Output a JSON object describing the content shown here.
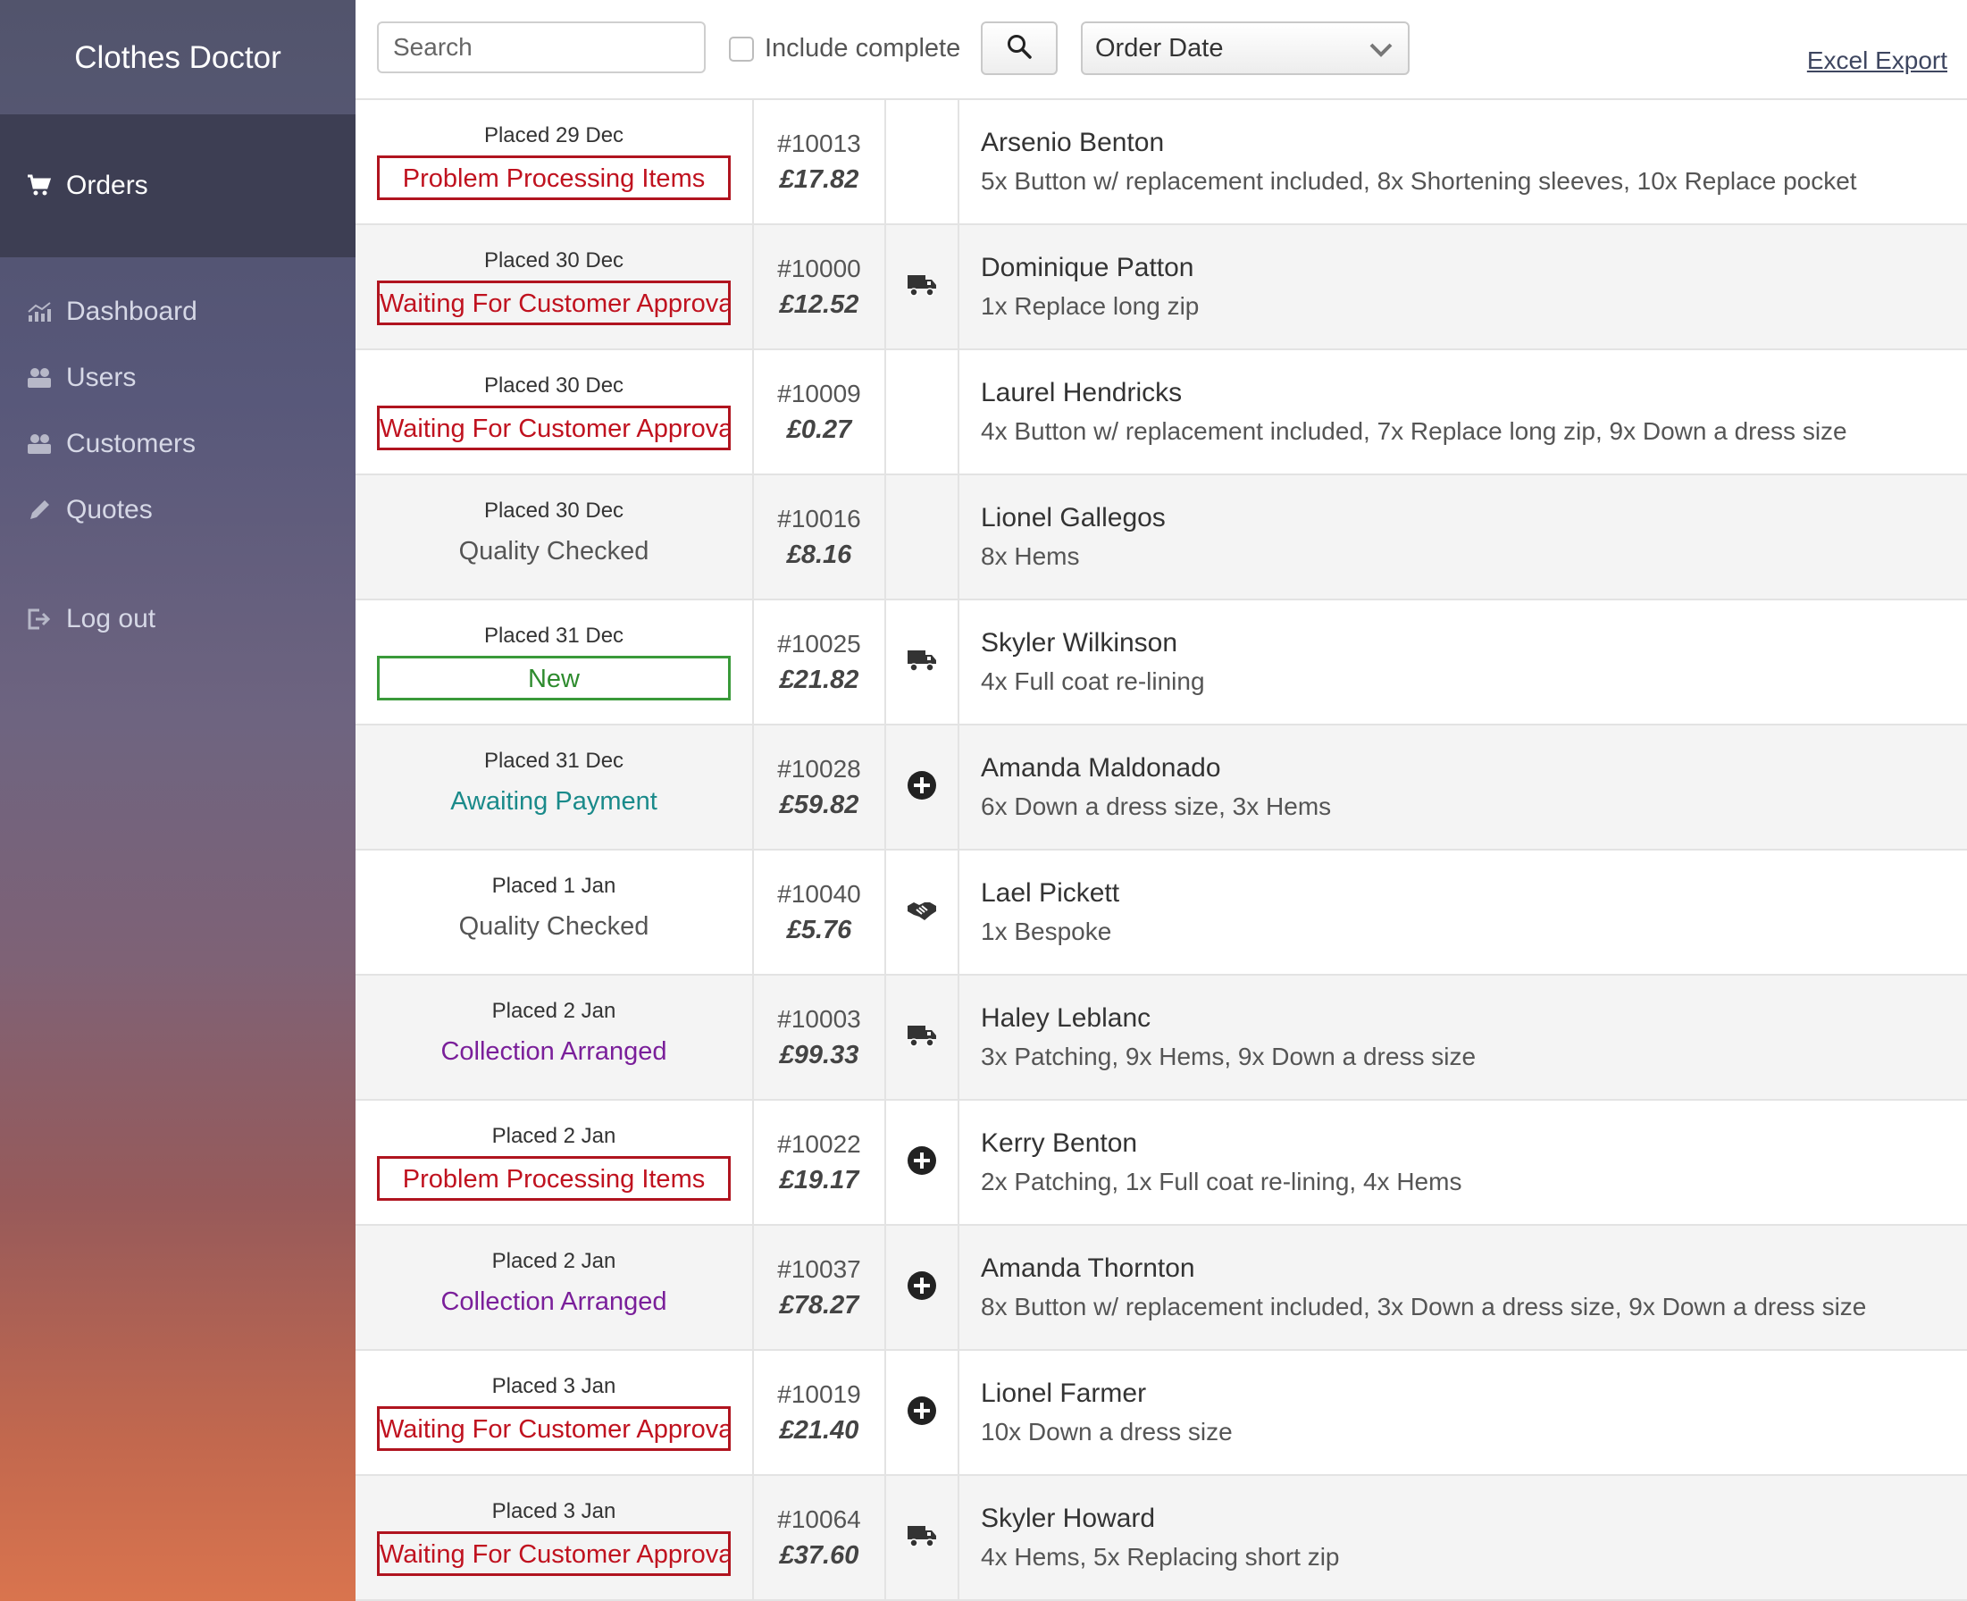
{
  "app": {
    "brand": "Clothes Doctor"
  },
  "sidebar": {
    "active": {
      "label": "Orders",
      "icon": "cart-icon"
    },
    "items": [
      {
        "label": "Dashboard",
        "icon": "chart-icon"
      },
      {
        "label": "Users",
        "icon": "users-icon"
      },
      {
        "label": "Customers",
        "icon": "users-icon"
      },
      {
        "label": "Quotes",
        "icon": "pencil-icon"
      }
    ],
    "logout": {
      "label": "Log out",
      "icon": "logout-icon"
    }
  },
  "toolbar": {
    "search_placeholder": "Search",
    "include_complete_label": "Include complete",
    "sort_value": "Order Date",
    "excel_export": "Excel Export"
  },
  "orders": [
    {
      "placed": "Placed 29 Dec",
      "status": "Problem Processing Items",
      "style": "red",
      "id": "#10013",
      "price": "£17.82",
      "icon": "",
      "customer": "Arsenio Benton",
      "items": "5x Button w/ replacement included, 8x Shortening sleeves, 10x Replace pocket"
    },
    {
      "placed": "Placed 30 Dec",
      "status": "Waiting For Customer Approval",
      "style": "red",
      "id": "#10000",
      "price": "£12.52",
      "icon": "truck",
      "customer": "Dominique Patton",
      "items": "1x Replace long zip"
    },
    {
      "placed": "Placed 30 Dec",
      "status": "Waiting For Customer Approval",
      "style": "red",
      "id": "#10009",
      "price": "£0.27",
      "icon": "",
      "customer": "Laurel Hendricks",
      "items": "4x Button w/ replacement included, 7x Replace long zip, 9x Down a dress size"
    },
    {
      "placed": "Placed 30 Dec",
      "status": "Quality Checked",
      "style": "plain",
      "id": "#10016",
      "price": "£8.16",
      "icon": "",
      "customer": "Lionel Gallegos",
      "items": "8x Hems"
    },
    {
      "placed": "Placed 31 Dec",
      "status": "New",
      "style": "green",
      "id": "#10025",
      "price": "£21.82",
      "icon": "truck",
      "customer": "Skyler Wilkinson",
      "items": "4x Full coat re-lining"
    },
    {
      "placed": "Placed 31 Dec",
      "status": "Awaiting Payment",
      "style": "teal",
      "id": "#10028",
      "price": "£59.82",
      "icon": "plus",
      "customer": "Amanda Maldonado",
      "items": "6x Down a dress size, 3x Hems"
    },
    {
      "placed": "Placed 1 Jan",
      "status": "Quality Checked",
      "style": "plain",
      "id": "#10040",
      "price": "£5.76",
      "icon": "handshake",
      "customer": "Lael Pickett",
      "items": "1x Bespoke"
    },
    {
      "placed": "Placed 2 Jan",
      "status": "Collection Arranged",
      "style": "purple",
      "id": "#10003",
      "price": "£99.33",
      "icon": "truck",
      "customer": "Haley Leblanc",
      "items": "3x Patching, 9x Hems, 9x Down a dress size"
    },
    {
      "placed": "Placed 2 Jan",
      "status": "Problem Processing Items",
      "style": "red",
      "id": "#10022",
      "price": "£19.17",
      "icon": "plus",
      "customer": "Kerry Benton",
      "items": "2x Patching, 1x Full coat re-lining, 4x Hems"
    },
    {
      "placed": "Placed 2 Jan",
      "status": "Collection Arranged",
      "style": "purple",
      "id": "#10037",
      "price": "£78.27",
      "icon": "plus",
      "customer": "Amanda Thornton",
      "items": "8x Button w/ replacement included, 3x Down a dress size, 9x Down a dress size"
    },
    {
      "placed": "Placed 3 Jan",
      "status": "Waiting For Customer Approval",
      "style": "red",
      "id": "#10019",
      "price": "£21.40",
      "icon": "plus",
      "customer": "Lionel Farmer",
      "items": "10x Down a dress size"
    },
    {
      "placed": "Placed 3 Jan",
      "status": "Waiting For Customer Approval",
      "style": "red",
      "id": "#10064",
      "price": "£37.60",
      "icon": "truck",
      "customer": "Skyler Howard",
      "items": "4x Hems, 5x Replacing short zip"
    }
  ]
}
